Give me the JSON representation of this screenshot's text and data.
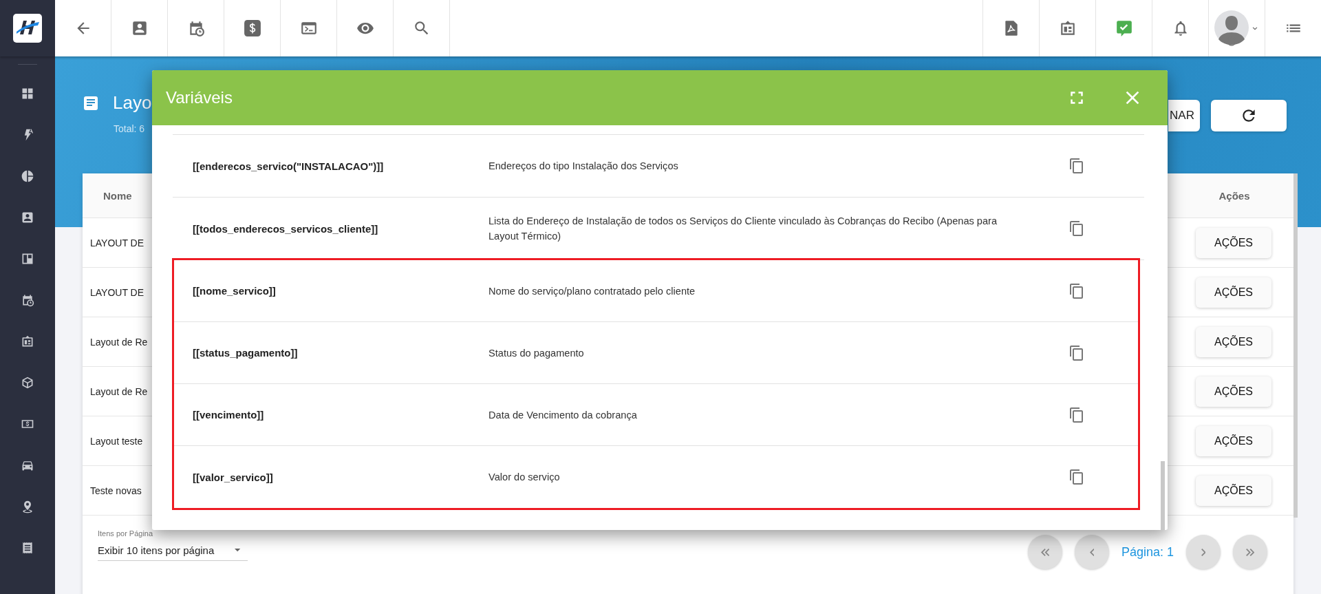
{
  "page": {
    "title": "Layo",
    "total": "Total: 6",
    "buttons": [
      {
        "label": "NAR",
        "kind": "text"
      },
      {
        "kind": "refresh"
      }
    ],
    "table": {
      "columns": [
        "Nome",
        "Ações"
      ],
      "rows": [
        {
          "name": "LAYOUT DE",
          "action": "AÇÕES"
        },
        {
          "name": "LAYOUT DE",
          "action": "AÇÕES"
        },
        {
          "name": "Layout de Re",
          "action": "AÇÕES"
        },
        {
          "name": "Layout de Re",
          "action": "AÇÕES"
        },
        {
          "name": "Layout teste",
          "action": "AÇÕES"
        },
        {
          "name": "Teste novas",
          "action": "AÇÕES"
        }
      ]
    },
    "pagination": {
      "per_page_label": "Itens por Página",
      "per_page_value": "Exibir 10 itens por página",
      "page": "Página: 1"
    }
  },
  "modal": {
    "title": "Variáveis",
    "variables": [
      {
        "name": "[[enderecos_servico(\"INSTALACAO\")]]",
        "description": "Endereços do tipo Instalação dos Serviços",
        "highlighted": false
      },
      {
        "name": "[[todos_enderecos_servicos_cliente]]",
        "description": "Lista do Endereço de Instalação de todos os Serviços do Cliente vinculado às Cobranças do Recibo (Apenas para Layout Térmico)",
        "highlighted": false
      },
      {
        "name": "[[nome_servico]]",
        "description": "Nome do serviço/plano contratado pelo cliente",
        "highlighted": true
      },
      {
        "name": "[[status_pagamento]]",
        "description": "Status do pagamento",
        "highlighted": true
      },
      {
        "name": "[[vencimento]]",
        "description": "Data de Vencimento da cobrança",
        "highlighted": true
      },
      {
        "name": "[[valor_servico]]",
        "description": "Valor do serviço",
        "highlighted": true
      }
    ]
  }
}
